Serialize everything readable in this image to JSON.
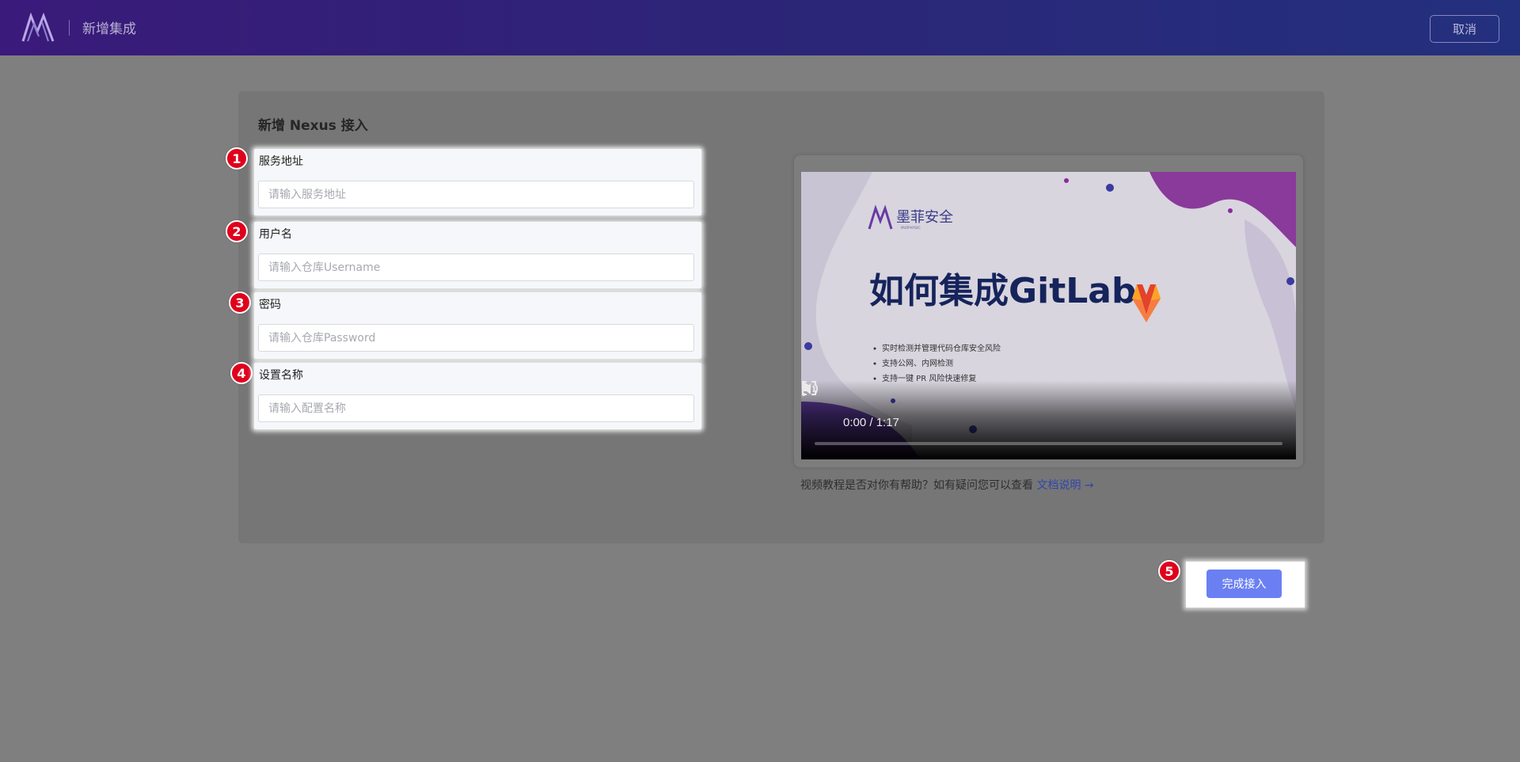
{
  "header": {
    "title": "新增集成",
    "cancel_label": "取消"
  },
  "card": {
    "title": "新增 Nexus 接入"
  },
  "form": {
    "fields": [
      {
        "badge": "1",
        "label": "服务地址",
        "placeholder": "请输入服务地址",
        "value": ""
      },
      {
        "badge": "2",
        "label": "用户名",
        "placeholder": "请输入仓库Username",
        "value": ""
      },
      {
        "badge": "3",
        "label": "密码",
        "placeholder": "请输入仓库Password",
        "value": ""
      },
      {
        "badge": "4",
        "label": "设置名称",
        "placeholder": "请输入配置名称",
        "value": ""
      }
    ]
  },
  "video": {
    "brand": "墨菲安全",
    "brand_sub": "MURPHYSEC",
    "headline": "如何集成GitLab",
    "bullets": [
      "实时检测并管理代码仓库安全风险",
      "支持公网、内网检测",
      "支持一键 PR 风险快速修复"
    ],
    "time": "0:00 / 1:17",
    "progress": 0
  },
  "help": {
    "text": "视频教程是否对你有帮助？如有疑问您可以查看",
    "link_label": "文档说明 →"
  },
  "submit": {
    "badge": "5",
    "label": "完成接入"
  },
  "colors": {
    "header_start": "#3a1a7a",
    "header_end": "#23307e",
    "primary_button": "#6a80f2",
    "badge": "#e0001b",
    "link": "#3146a8"
  }
}
